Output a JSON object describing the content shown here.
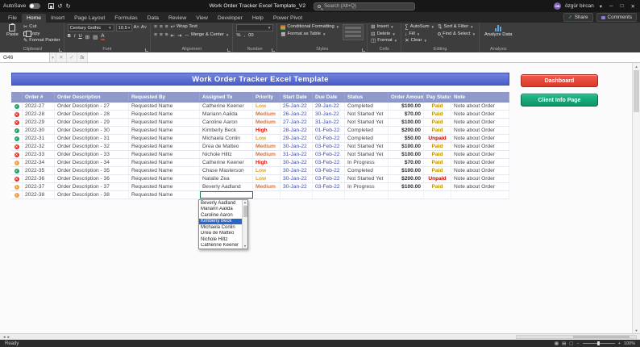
{
  "titlebar": {
    "autosave_label": "AutoSave",
    "title": "Work Order Tracker Excel Template_V2",
    "search_placeholder": "Search (Alt+Q)",
    "user_name": "özgür bircan",
    "user_initials": "ÖB"
  },
  "ribbon": {
    "tabs": [
      {
        "label": "File",
        "active": false
      },
      {
        "label": "Home",
        "active": true
      },
      {
        "label": "Insert",
        "active": false
      },
      {
        "label": "Page Layout",
        "active": false
      },
      {
        "label": "Formulas",
        "active": false
      },
      {
        "label": "Data",
        "active": false
      },
      {
        "label": "Review",
        "active": false
      },
      {
        "label": "View",
        "active": false
      },
      {
        "label": "Developer",
        "active": false
      },
      {
        "label": "Help",
        "active": false
      },
      {
        "label": "Power Pivot",
        "active": false
      }
    ],
    "share_label": "Share",
    "comments_label": "Comments",
    "clipboard": {
      "label": "Clipboard",
      "paste": "Paste",
      "cut": "Cut",
      "copy": "Copy",
      "format_painter": "Format Painter"
    },
    "font": {
      "label": "Font",
      "family": "Century Gothic",
      "size": "10.5"
    },
    "alignment": {
      "label": "Alignment",
      "wrap_text": "Wrap Text",
      "merge_center": "Merge & Center"
    },
    "number": {
      "label": "Number"
    },
    "styles": {
      "label": "Styles",
      "conditional": "Conditional Formatting",
      "format_table": "Format as Table"
    },
    "cells": {
      "label": "Cells",
      "insert": "Insert",
      "delete": "Delete",
      "format": "Format"
    },
    "editing": {
      "label": "Editing",
      "autosum": "AutoSum",
      "fill": "Fill",
      "clear": "Clear",
      "sort_filter": "Sort & Filter",
      "find_select": "Find & Select"
    },
    "analysis": {
      "label": "Analysis",
      "analyze": "Analyze Data"
    }
  },
  "formula_bar": {
    "name_box": "G46",
    "fx": "fx"
  },
  "worksheet": {
    "title": "Work Order Tracker Excel Template",
    "buttons": {
      "dashboard": "Dashboard",
      "client_info": "Client Info Page"
    },
    "columns": [
      "",
      "Order #",
      "Order Description",
      "Requested By",
      "Assigned To",
      "Priority",
      "Start Date",
      "Due Date",
      "Status",
      "Order Amount",
      "Pay Status",
      "Note"
    ],
    "rows": [
      {
        "icon": "check",
        "order": "2022-27",
        "desc": "Order Description - 27",
        "requested": "Requested Name",
        "assigned": "Catherine Keener",
        "priority": "Low",
        "start": "25-Jan-22",
        "due": "29-Jan-22",
        "status": "Completed",
        "amount": "$100.00",
        "pay": "Paid",
        "note": "Note about Order"
      },
      {
        "icon": "cross",
        "order": "2022-28",
        "desc": "Order Description - 28",
        "requested": "Requested Name",
        "assigned": "Mariann Aalida",
        "priority": "Medium",
        "start": "26-Jan-22",
        "due": "30-Jan-22",
        "status": "Not Started Yet",
        "amount": "$70.00",
        "pay": "Paid",
        "note": "Note about Order"
      },
      {
        "icon": "cross",
        "order": "2022-29",
        "desc": "Order Description - 29",
        "requested": "Requested Name",
        "assigned": "Caroline Aaron",
        "priority": "Medium",
        "start": "27-Jan-22",
        "due": "31-Jan-22",
        "status": "Not Started Yet",
        "amount": "$100.00",
        "pay": "Paid",
        "note": "Note about Order"
      },
      {
        "icon": "check",
        "order": "2022-30",
        "desc": "Order Description - 30",
        "requested": "Requested Name",
        "assigned": "Kimberly Beck",
        "priority": "High",
        "start": "28-Jan-22",
        "due": "01-Feb-22",
        "status": "Completed",
        "amount": "$200.00",
        "pay": "Paid",
        "note": "Note about Order"
      },
      {
        "icon": "check",
        "order": "2022-31",
        "desc": "Order Description - 31",
        "requested": "Requested Name",
        "assigned": "Michaela Conlin",
        "priority": "Low",
        "start": "29-Jan-22",
        "due": "02-Feb-22",
        "status": "Completed",
        "amount": "$50.00",
        "pay": "Unpaid",
        "note": "Note about Order"
      },
      {
        "icon": "cross",
        "order": "2022-32",
        "desc": "Order Description - 32",
        "requested": "Requested Name",
        "assigned": "Drea de Matteo",
        "priority": "Medium",
        "start": "30-Jan-22",
        "due": "03-Feb-22",
        "status": "Not Started Yet",
        "amount": "$100.00",
        "pay": "Paid",
        "note": "Note about Order"
      },
      {
        "icon": "cross",
        "order": "2022-33",
        "desc": "Order Description - 33",
        "requested": "Requested Name",
        "assigned": "Nichole Hiltz",
        "priority": "Medium",
        "start": "31-Jan-22",
        "due": "03-Feb-22",
        "status": "Not Started Yet",
        "amount": "$100.00",
        "pay": "Paid",
        "note": "Note about Order"
      },
      {
        "icon": "progress",
        "order": "2022-34",
        "desc": "Order Description - 34",
        "requested": "Requested Name",
        "assigned": "Catherine Keener",
        "priority": "High",
        "start": "30-Jan-22",
        "due": "03-Feb-22",
        "status": "In Progress",
        "amount": "$70.00",
        "pay": "Paid",
        "note": "Note about Order"
      },
      {
        "icon": "check",
        "order": "2022-35",
        "desc": "Order Description - 35",
        "requested": "Requested Name",
        "assigned": "Chase Masterson",
        "priority": "Low",
        "start": "30-Jan-22",
        "due": "03-Feb-22",
        "status": "Completed",
        "amount": "$100.00",
        "pay": "Paid",
        "note": "Note about Order"
      },
      {
        "icon": "cross",
        "order": "2022-36",
        "desc": "Order Description - 36",
        "requested": "Requested Name",
        "assigned": "Natalie Zea",
        "priority": "Low",
        "start": "30-Jan-22",
        "due": "03-Feb-22",
        "status": "Not Started Yet",
        "amount": "$200.00",
        "pay": "Unpaid",
        "note": "Note about Order"
      },
      {
        "icon": "progress",
        "order": "2022-37",
        "desc": "Order Description - 37",
        "requested": "Requested Name",
        "assigned": "Beverly Aadland",
        "priority": "Medium",
        "start": "30-Jan-22",
        "due": "03-Feb-22",
        "status": "In Progress",
        "amount": "$100.00",
        "pay": "Paid",
        "note": "Note about Order"
      },
      {
        "icon": "progress",
        "order": "2022-38",
        "desc": "Order Description - 38",
        "requested": "Requested Name",
        "assigned": "",
        "priority": "",
        "start": "",
        "due": "",
        "status": "",
        "amount": "",
        "pay": "",
        "note": "",
        "editing": true
      }
    ],
    "dropdown": {
      "options": [
        "Beverly Aadland",
        "Mariann Aalida",
        "Caroline Aaron",
        "Kimberly Beck",
        "Michaela Conlin",
        "Drea de Matteo",
        "Nichole Hiltz",
        "Catherine Keener"
      ],
      "selected": "Kimberly Beck"
    }
  },
  "status_bar": {
    "ready": "Ready",
    "zoom": "100%"
  },
  "colors": {
    "title_band": "#4a5ec9",
    "header_row": "#8f9aca",
    "priority": {
      "Low": "#DFA32D",
      "Medium": "#E0702F",
      "High": "#D21F12"
    },
    "pay": {
      "Paid": "#BF8F00",
      "Unpaid": "#C00000"
    },
    "status_icon": {
      "check": "#21A366",
      "cross": "#D83B2D",
      "progress": "#F2A23C"
    },
    "status_glyph": {
      "check": "✓",
      "cross": "✕",
      "progress": "!"
    },
    "date_text": "#3949ab",
    "dashboard_button": "#E0392B",
    "client_button": "#12996C"
  }
}
